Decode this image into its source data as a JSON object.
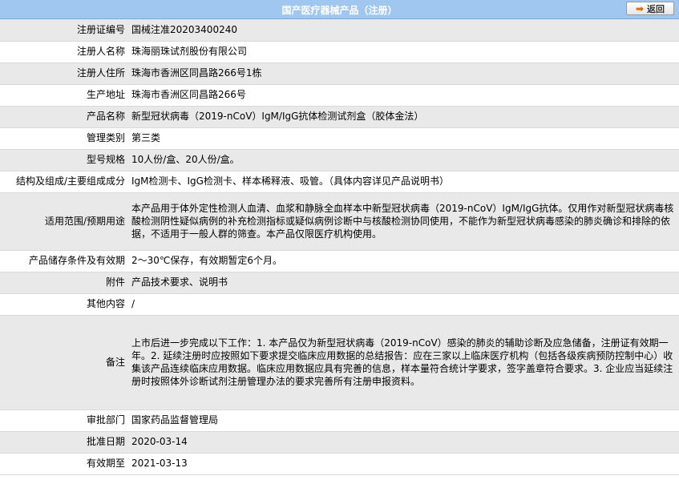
{
  "header": {
    "title": "国产医疗器械产品（注册）",
    "back_label": "返回"
  },
  "rows": [
    {
      "label": "注册证编号",
      "value": "国械注准20203400240"
    },
    {
      "label": "注册人名称",
      "value": "珠海丽珠试剂股份有限公司"
    },
    {
      "label": "注册人住所",
      "value": "珠海市香洲区同昌路266号1栋"
    },
    {
      "label": "生产地址",
      "value": "珠海市香洲区同昌路266号"
    },
    {
      "label": "产品名称",
      "value": "新型冠状病毒（2019-nCoV）IgM/IgG抗体检测试剂盒（胶体金法）"
    },
    {
      "label": "管理类别",
      "value": "第三类"
    },
    {
      "label": "型号规格",
      "value": "10人份/盒、20人份/盒。"
    },
    {
      "label": "结构及组成/主要组成成分",
      "value": "IgM检测卡、IgG检测卡、样本稀释液、吸管。（具体内容详见产品说明书）"
    },
    {
      "label": "适用范围/预期用途",
      "value": "本产品用于体外定性检测人血清、血浆和静脉全血样本中新型冠状病毒（2019-nCoV）IgM/IgG抗体。仅用作对新型冠状病毒核酸检测阴性疑似病例的补充检测指标或疑似病例诊断中与核酸检测协同使用，不能作为新型冠状病毒感染的肺炎确诊和排除的依据，不适用于一般人群的筛查。本产品仅限医疗机构使用。"
    },
    {
      "label": "产品储存条件及有效期",
      "value": "2～30℃保存，有效期暂定6个月。"
    },
    {
      "label": "附件",
      "value": "产品技术要求、说明书"
    },
    {
      "label": "其他内容",
      "value": "/"
    },
    {
      "label": "备注",
      "value": "上市后进一步完成以下工作：1. 本产品仅为新型冠状病毒（2019-nCoV）感染的肺炎的辅助诊断及应急储备，注册证有效期一年。2. 延续注册时应按照如下要求提交临床应用数据的总结报告：应在三家以上临床医疗机构（包括各级疾病预防控制中心）收集该产品连续临床应用数据。临床应用数据应具有完善的信息，样本量符合统计学要求，签字盖章符合要求。3. 企业应当延续注册时按照体外诊断试剂注册管理办法的要求完善所有注册申报资料。"
    },
    {
      "label": "审批部门",
      "value": "国家药品监督管理局"
    },
    {
      "label": "批准日期",
      "value": "2020-03-14"
    },
    {
      "label": "有效期至",
      "value": "2021-03-13"
    }
  ]
}
